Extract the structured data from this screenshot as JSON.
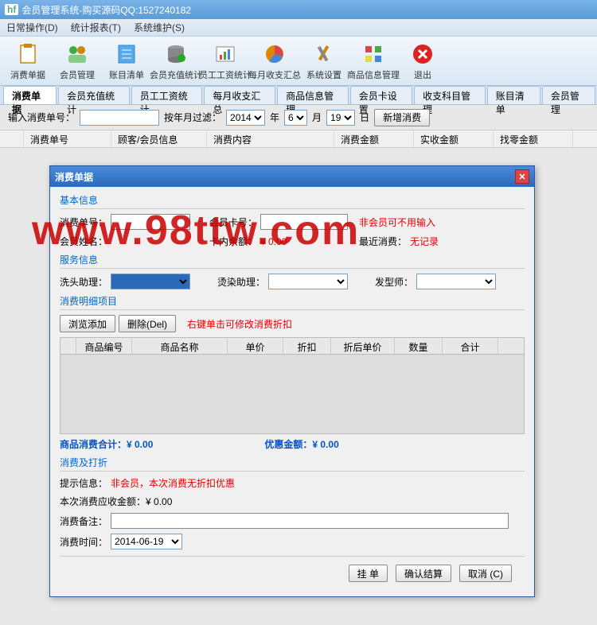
{
  "titlebar": {
    "app_icon": "hf",
    "title": "会员管理系统-购买源码QQ:1527240182"
  },
  "menubar": {
    "items": [
      "日常操作(D)",
      "统计报表(T)",
      "系统维护(S)"
    ]
  },
  "toolbar": {
    "items": [
      {
        "label": "消费单据"
      },
      {
        "label": "会员管理"
      },
      {
        "label": "账目清单"
      },
      {
        "label": "会员充值统计"
      },
      {
        "label": "员工工资统计"
      },
      {
        "label": "每月收支汇总"
      },
      {
        "label": "系统设置"
      },
      {
        "label": "商品信息管理"
      },
      {
        "label": "退出"
      }
    ]
  },
  "tabs": {
    "items": [
      "消费单据",
      "会员充值统计",
      "员工工资统计",
      "每月收支汇总",
      "商品信息管理",
      "会员卡设置",
      "收支科目管理",
      "账目清单",
      "会员管理"
    ],
    "active": 0
  },
  "filter": {
    "label_input": "输入消费单号：",
    "label_by": "按年月过滤：",
    "year": "2014",
    "year_unit": "年",
    "month": "6",
    "month_unit": "月",
    "day": "19",
    "day_unit": "日",
    "add_btn": "新增消费"
  },
  "grid": {
    "headers": [
      "消费单号",
      "顾客/会员信息",
      "消费内容",
      "消费金额",
      "实收金额",
      "找零金额"
    ]
  },
  "dialog": {
    "title": "消费单据",
    "basic": {
      "group": "基本信息",
      "bill_no_label": "消费单号：",
      "card_no_label": "会员卡号：",
      "card_note": "非会员可不用输入",
      "name_label": "会员姓名：",
      "balance_label": "卡内余额：",
      "balance_value": "¥ 0.00",
      "last_label": "最近消费：",
      "last_value": "无记录"
    },
    "service": {
      "group": "服务信息",
      "wash_label": "洗头助理：",
      "dye_label": "烫染助理：",
      "stylist_label": "发型师："
    },
    "detail": {
      "group": "消费明细项目",
      "browse_btn": "浏览添加",
      "del_btn": "删除(Del)",
      "hint": "右键单击可修改消费折扣",
      "headers": [
        "商品编号",
        "商品名称",
        "单价",
        "折扣",
        "折后单价",
        "数量",
        "合计"
      ]
    },
    "totals": {
      "goods": "商品消费合计：¥ 0.00",
      "discount": "优惠金额：¥ 0.00"
    },
    "pay": {
      "group": "消费及打折",
      "info_label": "提示信息：",
      "info_value": "非会员，本次消费无折扣优惠",
      "due_label": "本次消费应收金额：¥ 0.00",
      "remark_label": "消费备注：",
      "time_label": "消费时间：",
      "time_value": "2014-06-19"
    },
    "footer": {
      "hold": "挂 单",
      "confirm": "确认结算",
      "cancel": "取消 (C)"
    }
  },
  "watermark": "www.98ttw.com"
}
